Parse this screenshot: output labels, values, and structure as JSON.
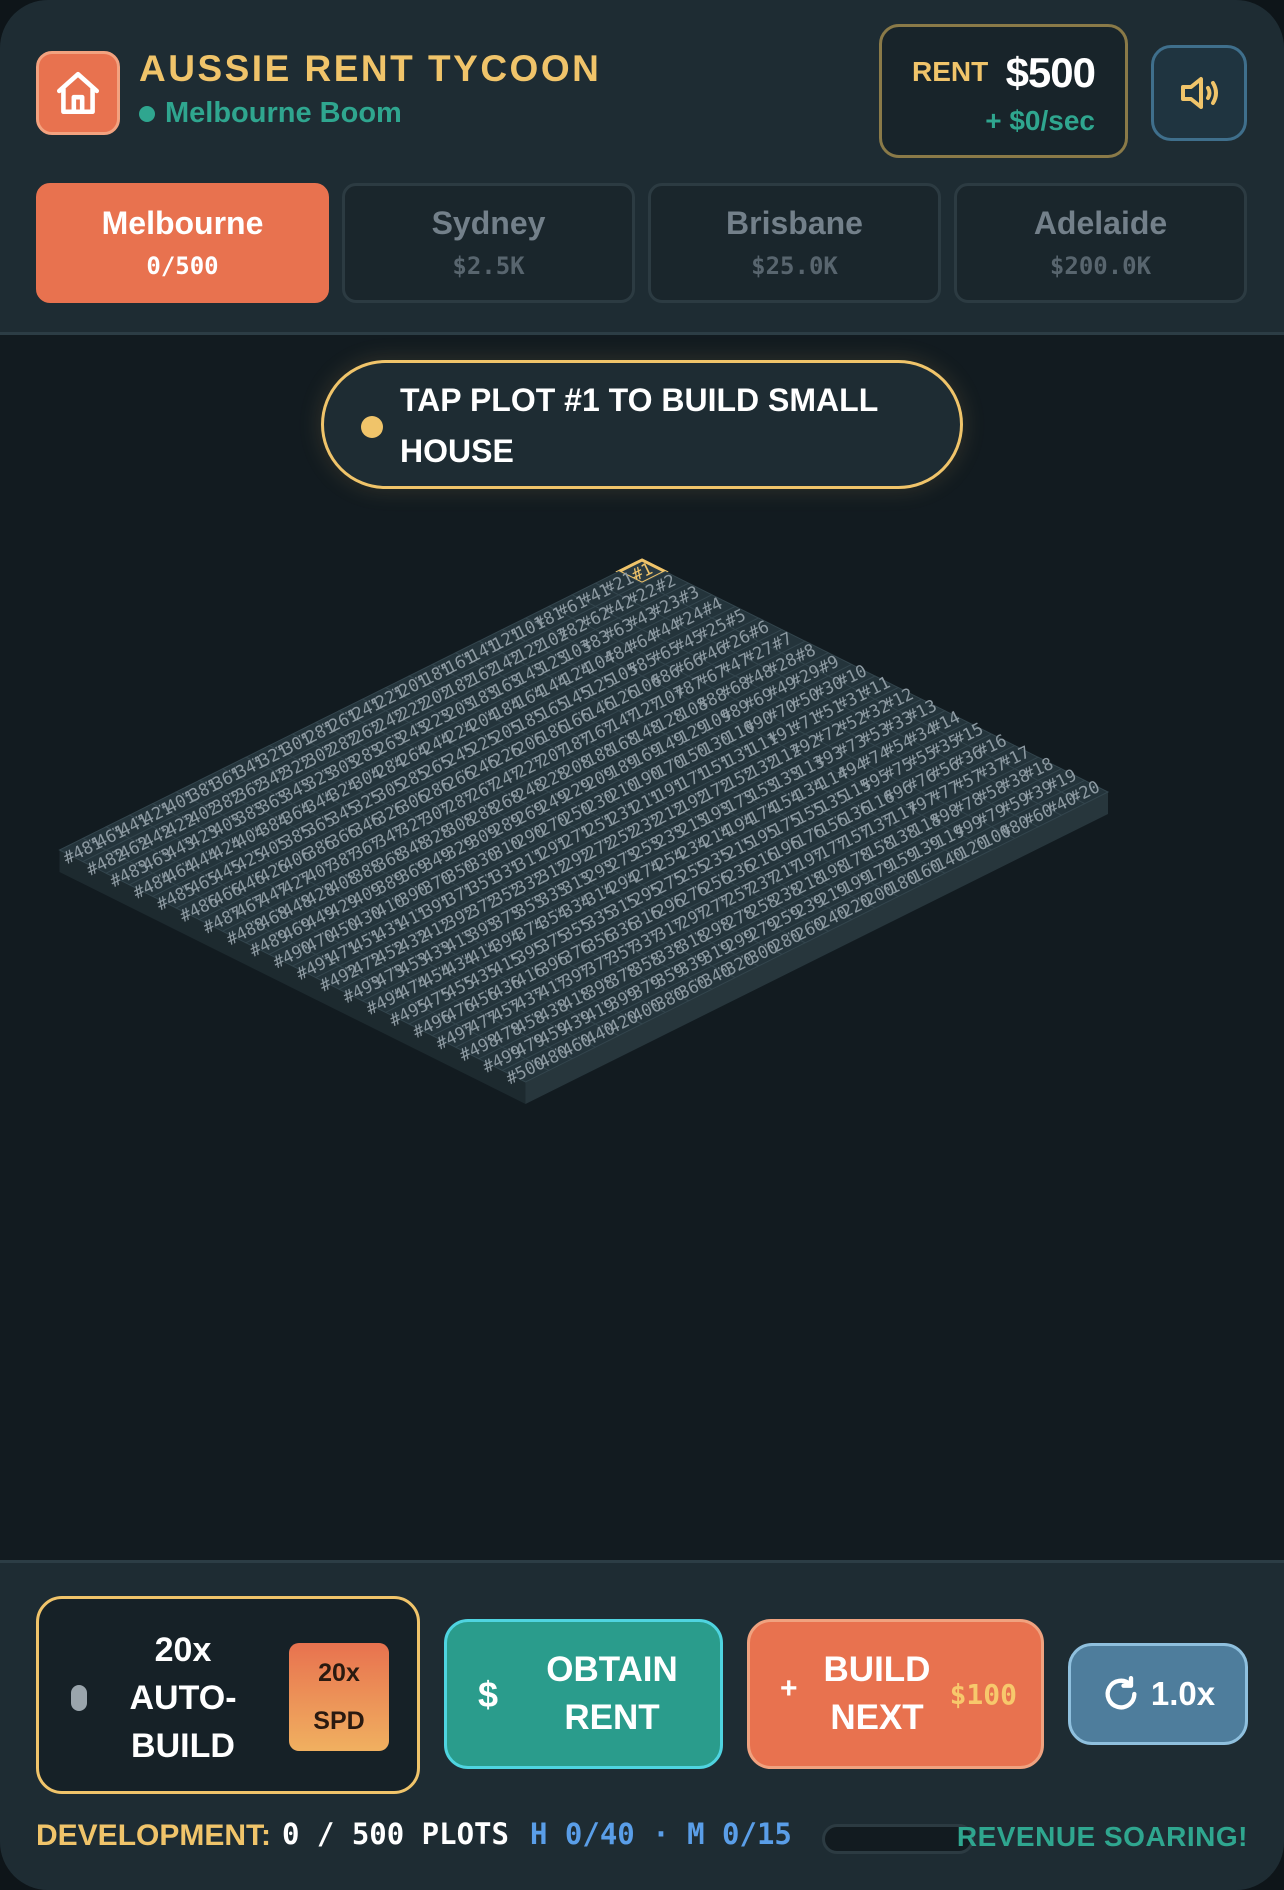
{
  "app": {
    "title": "AUSSIE RENT TYCOON",
    "region": "Melbourne Boom",
    "logo_icon": "house-icon",
    "colors": {
      "accent": "#e8724f",
      "gold": "#f0c46a",
      "teal": "#2fa68f",
      "blue": "#5a9ee8"
    }
  },
  "rent": {
    "label": "RENT",
    "value": "$500",
    "rate": "+ $0/sec"
  },
  "sound": {
    "icon": "speaker-icon"
  },
  "cities": [
    {
      "name": "Melbourne",
      "sub": "0/500",
      "active": true
    },
    {
      "name": "Sydney",
      "sub": "$2.5K",
      "active": false
    },
    {
      "name": "Brisbane",
      "sub": "$25.0K",
      "active": false
    },
    {
      "name": "Adelaide",
      "sub": "$200.0K",
      "active": false
    }
  ],
  "hint": {
    "text": "TAP PLOT #1 TO BUILD SMALL HOUSE"
  },
  "board": {
    "plot_prefix": "#",
    "total_plots": 500,
    "highlighted_plot": 1
  },
  "actions": {
    "auto_build": {
      "label": "20x AUTO-BUILD",
      "badge_top": "20x",
      "badge_bottom": "SPD"
    },
    "obtain_rent": {
      "icon": "$",
      "label": "OBTAIN RENT"
    },
    "build_next": {
      "icon": "+",
      "label": "BUILD NEXT",
      "cost": "$100"
    },
    "speed": {
      "icon": "refresh-icon",
      "label": "1.0x"
    }
  },
  "status": {
    "dev_label": "DEVELOPMENT:",
    "dev_count": "0 / 500 PLOTS",
    "dev_hm": "H 0/40 · M 0/15",
    "progress": 0,
    "message": "REVENUE SOARING!"
  }
}
